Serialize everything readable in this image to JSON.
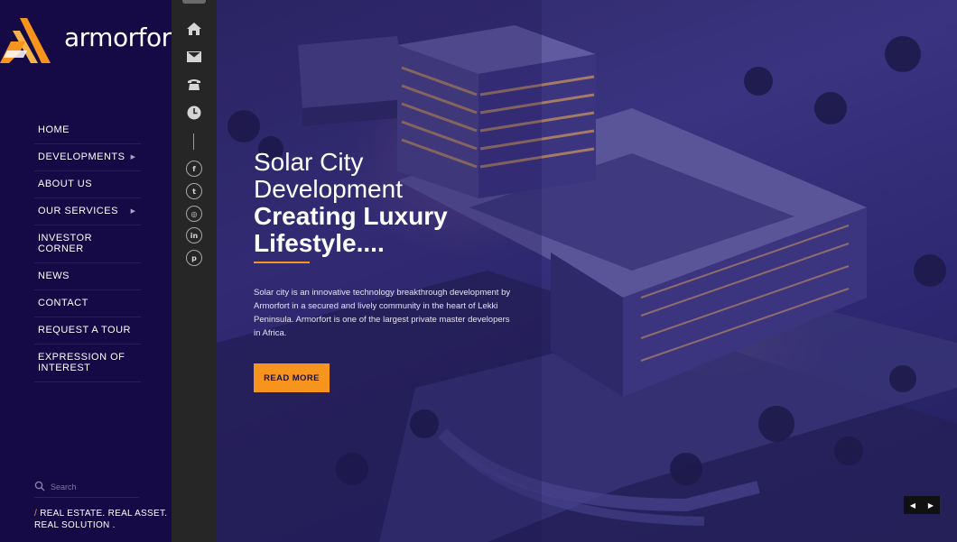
{
  "brand": {
    "name": "armorfort",
    "accent": "#f7941d",
    "sidebar_bg": "#150a45"
  },
  "menu": [
    {
      "label": "HOME",
      "has_submenu": false
    },
    {
      "label": "DEVELOPMENTS",
      "has_submenu": true
    },
    {
      "label": "ABOUT US",
      "has_submenu": false
    },
    {
      "label": "OUR SERVICES",
      "has_submenu": true
    },
    {
      "label": "INVESTOR CORNER",
      "has_submenu": false
    },
    {
      "label": "NEWS",
      "has_submenu": false
    },
    {
      "label": "CONTACT",
      "has_submenu": false
    },
    {
      "label": "REQUEST A TOUR",
      "has_submenu": false
    },
    {
      "label": "EXPRESSION OF INTEREST",
      "has_submenu": false
    }
  ],
  "search": {
    "placeholder": "Search"
  },
  "tagline": {
    "slash": "/",
    "text": "REAL ESTATE. REAL ASSET. REAL SOLUTION ."
  },
  "iconbar": {
    "icons": [
      "home-icon",
      "mail-icon",
      "phone-icon",
      "clock-icon"
    ],
    "social": [
      {
        "name": "facebook-icon",
        "glyph": "f"
      },
      {
        "name": "twitter-icon",
        "glyph": "t"
      },
      {
        "name": "instagram-icon",
        "glyph": "◎"
      },
      {
        "name": "linkedin-icon",
        "glyph": "in"
      },
      {
        "name": "pinterest-icon",
        "glyph": "p"
      }
    ]
  },
  "hero": {
    "title_line1": "Solar City",
    "title_line2": "Development",
    "title_line3": "Creating Luxury",
    "title_line4": "Lifestyle....",
    "paragraph": "Solar city is an innovative technology breakthrough development by Armorfort in a secured and lively community in the heart of Lekki Peninsula. Armorfort is one of the largest private master developers in Africa.",
    "button": "READ MORE",
    "prev": "◀",
    "next": "▶"
  }
}
